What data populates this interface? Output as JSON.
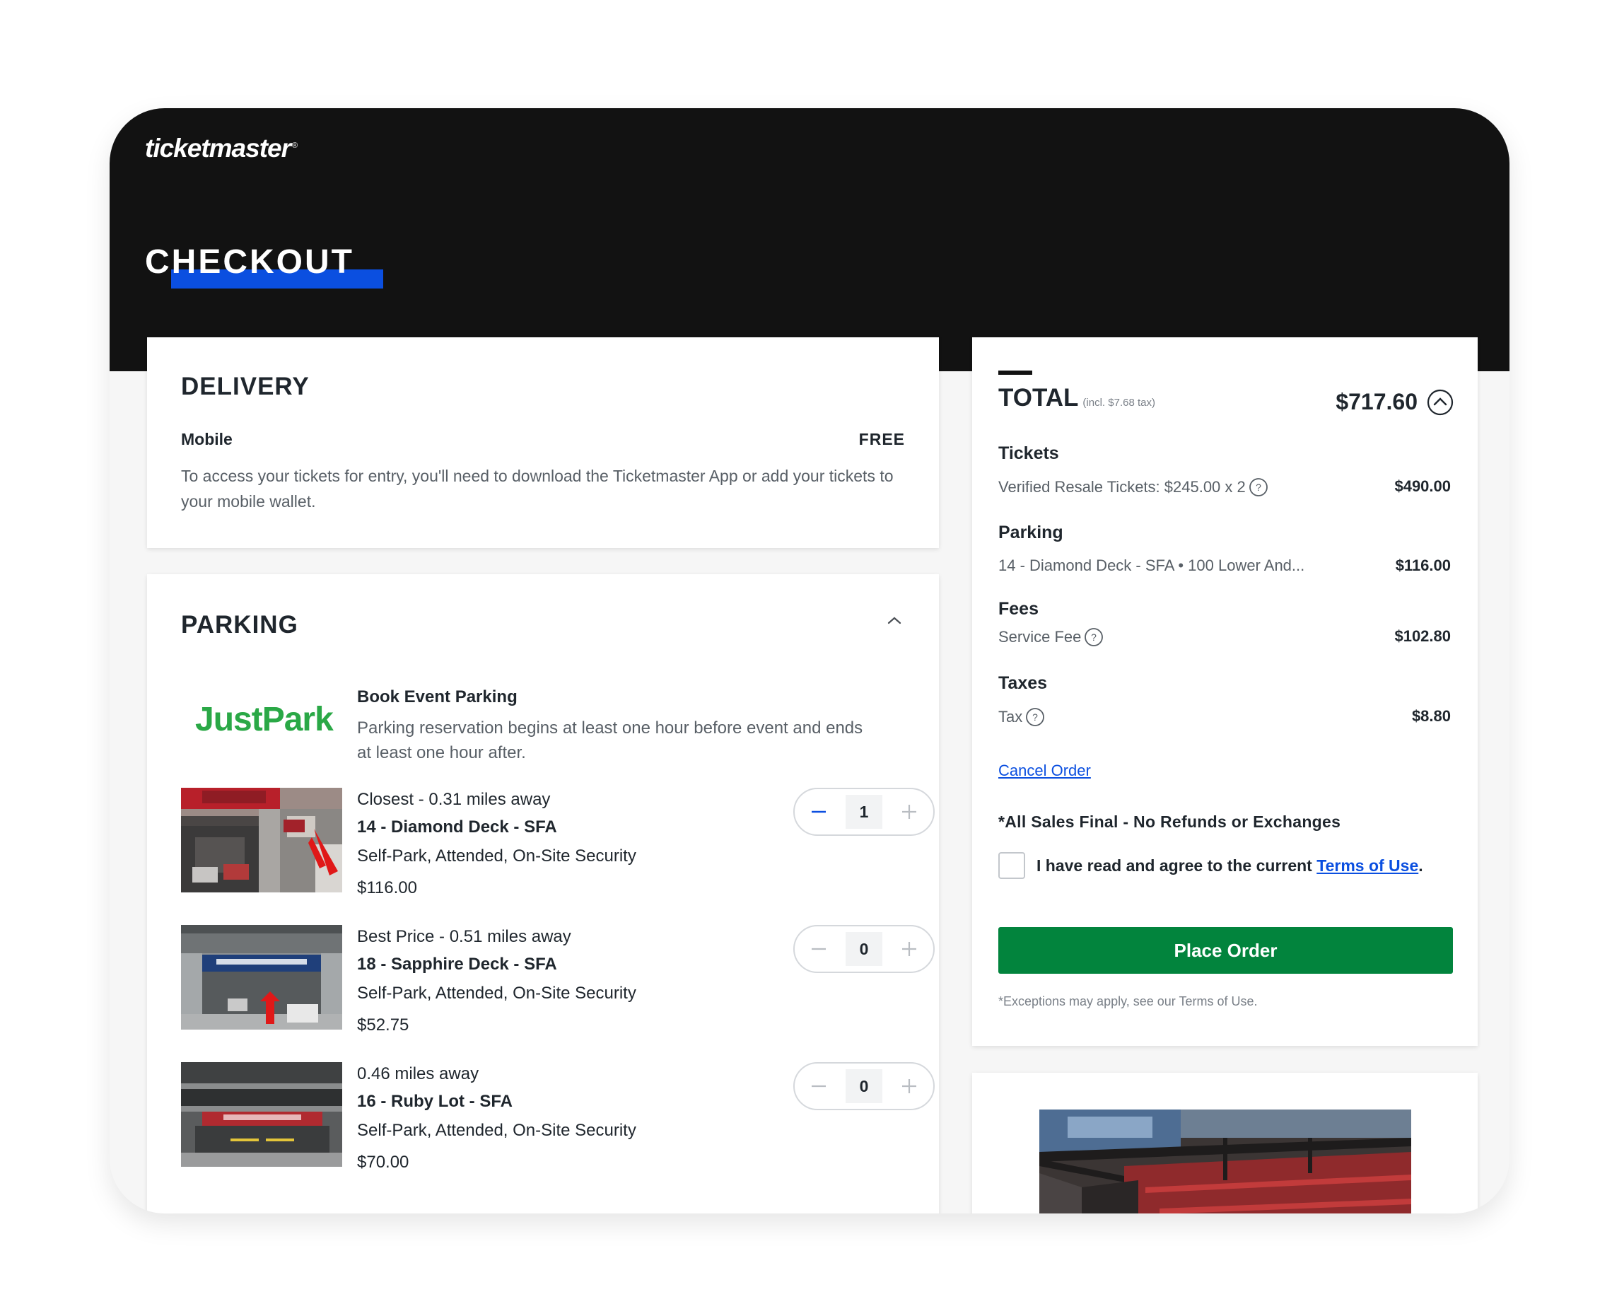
{
  "header": {
    "logo_text": "ticketmaster",
    "logo_mark": "®",
    "page_title": "CHECKOUT",
    "accent_color": "#0b4fe0"
  },
  "delivery": {
    "title": "DELIVERY",
    "method": "Mobile",
    "price": "FREE",
    "description": "To access your tickets for entry, you'll need to download the Ticketmaster App or add your tickets to your mobile wallet."
  },
  "parking": {
    "title": "PARKING",
    "provider_logo": "JustPark",
    "book_title": "Book Event Parking",
    "book_description": "Parking reservation begins at least one hour before event and ends at least one hour after.",
    "lots": [
      {
        "distance": "Closest - 0.31 miles away",
        "name": "14 - Diamond Deck - SFA",
        "features": "Self-Park, Attended, On-Site Security",
        "price": "$116.00",
        "quantity": "1"
      },
      {
        "distance": "Best Price - 0.51 miles away",
        "name": "18 - Sapphire Deck - SFA",
        "features": "Self-Park, Attended, On-Site Security",
        "price": "$52.75",
        "quantity": "0"
      },
      {
        "distance": "0.46 miles away",
        "name": "16 - Ruby Lot - SFA",
        "features": "Self-Park, Attended, On-Site Security",
        "price": "$70.00",
        "quantity": "0"
      }
    ]
  },
  "total": {
    "label": "TOTAL",
    "tax_note": "(incl. $7.68 tax)",
    "amount": "$717.60",
    "groups": {
      "tickets": {
        "title": "Tickets",
        "label": "Verified Resale Tickets: $245.00 x 2",
        "value": "$490.00"
      },
      "parking": {
        "title": "Parking",
        "label": "14 - Diamond Deck - SFA • 100 Lower And...",
        "value": "$116.00"
      },
      "fees": {
        "title": "Fees",
        "label": "Service Fee",
        "value": "$102.80"
      },
      "taxes": {
        "title": "Taxes",
        "label": "Tax",
        "value": "$8.80"
      }
    },
    "cancel_label": "Cancel Order",
    "final_note": "*All Sales Final - No Refunds or Exchanges",
    "agree_prefix": "I have read and agree to the current ",
    "agree_link": "Terms of Use",
    "agree_suffix": ".",
    "place_order_label": "Place Order",
    "place_order_color": "#02843d",
    "exceptions_note": "*Exceptions may apply, see our Terms of Use."
  }
}
